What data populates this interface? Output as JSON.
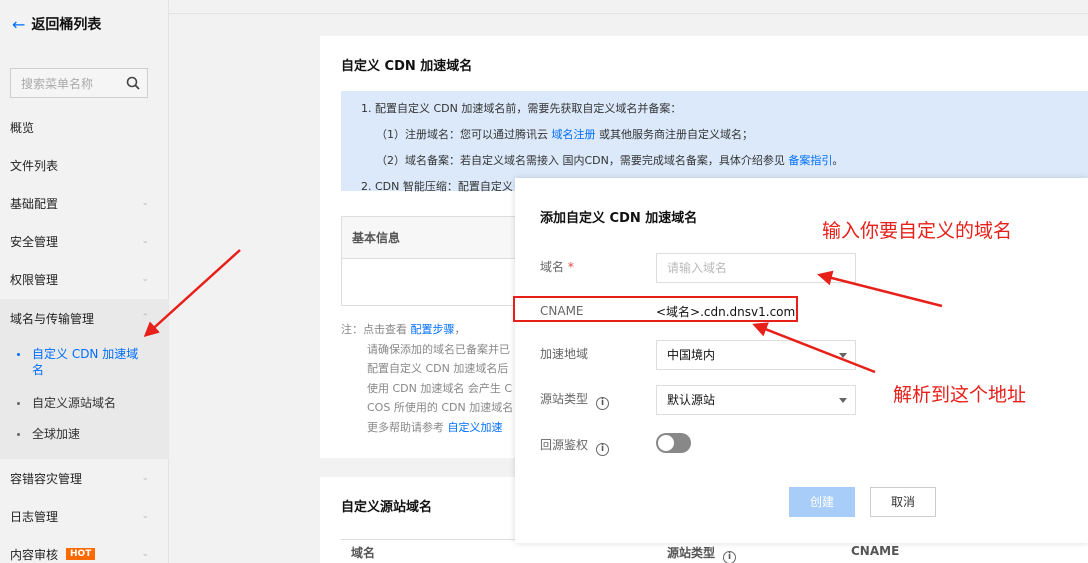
{
  "sidebar": {
    "back_label": "返回桶列表",
    "search_placeholder": "搜索菜单名称",
    "items": [
      {
        "label": "概览"
      },
      {
        "label": "文件列表"
      },
      {
        "label": "基础配置"
      },
      {
        "label": "安全管理"
      },
      {
        "label": "权限管理"
      },
      {
        "label": "域名与传输管理"
      },
      {
        "label": "容错容灾管理"
      },
      {
        "label": "日志管理"
      },
      {
        "label": "内容审核",
        "badge": "HOT"
      }
    ],
    "sub_items": [
      {
        "label": "自定义 CDN 加速域名",
        "active": true
      },
      {
        "label": "自定义源站域名"
      },
      {
        "label": "全球加速"
      }
    ]
  },
  "main": {
    "card1_title": "自定义 CDN 加速域名",
    "info": {
      "line1": "1. 配置自定义 CDN 加速域名前，需要先获取自定义域名并备案：",
      "line2_pre": "（1）注册域名：您可以通过腾讯云 ",
      "line2_link": "域名注册",
      "line2_post": " 或其他服务商注册自定义域名；",
      "line3_pre": "（2）域名备案：若自定义域名需接入 国内CDN，需要完成域名备案，具体介绍参见 ",
      "line3_link": "备案指引",
      "line3_post": "。",
      "line4": "2. CDN 智能压缩：配置自定义"
    },
    "basic_info_label": "基本信息",
    "notes": {
      "line1_pre": "注：点击查看 ",
      "line1_link": "配置步骤",
      "line1_post": "，",
      "line2": "请确保添加的域名已备案并已",
      "line3": "配置自定义 CDN 加速域名后",
      "line4": "使用 CDN 加速域名 会产生 C",
      "line5": "COS 所使用的 CDN 加速域名",
      "line6_pre": "更多帮助请参考 ",
      "line6_link": "自定义加速"
    },
    "card2_title": "自定义源站域名",
    "table_headers": {
      "domain": "域名",
      "origin_type": "源站类型",
      "cname": "CNAME"
    }
  },
  "modal": {
    "title": "添加自定义 CDN 加速域名",
    "domain_label": "域名",
    "domain_required": "*",
    "domain_placeholder": "请输入域名",
    "cname_label": "CNAME",
    "cname_value": "<域名>.cdn.dnsv1.com",
    "region_label": "加速地域",
    "region_value": "中国境内",
    "origin_type_label": "源站类型",
    "origin_type_value": "默认源站",
    "auth_label": "回源鉴权",
    "auth_enabled": false,
    "create_label": "创建",
    "cancel_label": "取消"
  },
  "annotations": {
    "domain_hint": "输入你要自定义的域名",
    "cname_hint": "解析到这个地址",
    "color": "#e8201a"
  },
  "colors": {
    "accent": "#006eff",
    "info_bg": "#dbe9fa",
    "hot_badge": "#ff6a00"
  }
}
